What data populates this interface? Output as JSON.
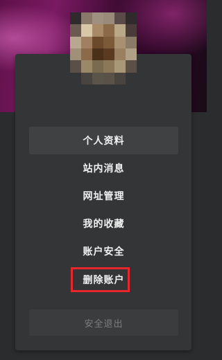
{
  "menu": {
    "items": [
      {
        "label": "个人资料"
      },
      {
        "label": "站内消息"
      },
      {
        "label": "网址管理"
      },
      {
        "label": "我的收藏"
      },
      {
        "label": "账户安全"
      },
      {
        "label": "删除账户"
      }
    ],
    "logout_label": "安全退出"
  },
  "colors": {
    "highlight_border": "#e8262b",
    "card_background": "#333537",
    "active_item_background": "#3f4143"
  },
  "icons": {
    "avatar": "pixelated-user-avatar"
  }
}
